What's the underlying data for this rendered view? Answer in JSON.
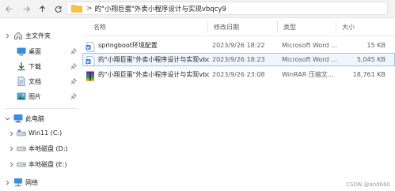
{
  "address_bar": {
    "separator": ">",
    "path": "的\"小翔巨蛋\"外卖小程序设计与实现vbqcy9"
  },
  "sidebar": {
    "items": [
      {
        "label": "主文件夹",
        "icon": "home-icon"
      },
      {
        "label": "桌面",
        "icon": "desktop-icon"
      },
      {
        "label": "下载",
        "icon": "download-icon"
      },
      {
        "label": "文档",
        "icon": "documents-icon"
      },
      {
        "label": "图片",
        "icon": "pictures-icon"
      },
      {
        "label": "此电脑",
        "icon": "computer-icon"
      },
      {
        "label": "Win11 (C:)",
        "icon": "drive-icon"
      },
      {
        "label": "本地磁盘 (D:)",
        "icon": "drive-icon"
      },
      {
        "label": "本地磁盘 (E:)",
        "icon": "drive-icon"
      },
      {
        "label": "网络",
        "icon": "network-icon"
      }
    ]
  },
  "columns": {
    "name": "名称",
    "modified": "修改日期",
    "type": "类型",
    "size": "大小"
  },
  "files": [
    {
      "name": "springboot环境配置",
      "modified": "2023/9/26 18:22",
      "type": "Microsoft Word ...",
      "size": "15 KB",
      "icon": "word-document-icon"
    },
    {
      "name": "的\"小翔巨蛋\"外卖小程序设计与实现vbq...",
      "modified": "2023/9/26 18:23",
      "type": "Microsoft Word ...",
      "size": "5,045 KB",
      "icon": "word-document-icon"
    },
    {
      "name": "的\"小翔巨蛋\"外卖小程序设计与实现vbq...",
      "modified": "2023/9/26 23:08",
      "type": "WinRAR 压缩文...",
      "size": "18,761 KB",
      "icon": "winrar-archive-icon"
    }
  ],
  "watermark": "CSDN @and660",
  "colors": {
    "selection_bg": "#f0f6fd",
    "selection_border": "#9fc3ec",
    "folder_yellow": "#f5c242",
    "word_blue": "#2b7cd3"
  }
}
